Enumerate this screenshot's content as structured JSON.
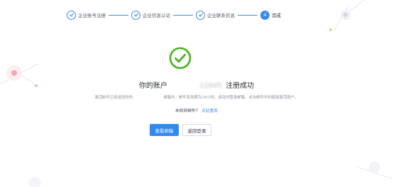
{
  "steps": [
    {
      "label": "企业账号注册",
      "state": "done"
    },
    {
      "label": "企业信息认证",
      "state": "done"
    },
    {
      "label": "企业联系信息",
      "state": "done"
    },
    {
      "label": "完成",
      "state": "active",
      "number": "4"
    }
  ],
  "result": {
    "title_prefix": "你的账户",
    "title_account_masked": "    22845",
    "title_suffix": "注册成功",
    "desc_prefix": "激活邮件已发送到你的",
    "desc_email_masked": "        ",
    "desc_suffix": "邮箱中，邮件有效期为24小时。请及时登录邮箱，点击邮件中的链接激活账户。",
    "resend_question": "未收到邮件?",
    "resend_link": "点此重发"
  },
  "actions": {
    "view_email": "查看邮箱",
    "back_login": "返回登录"
  },
  "colors": {
    "accent": "#2f8af0",
    "success": "#47b21a"
  },
  "icons": {
    "success": "check-circle-icon",
    "step_done": "check-icon"
  }
}
